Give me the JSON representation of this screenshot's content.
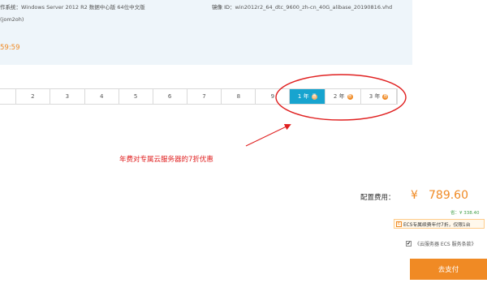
{
  "instance_info": {
    "os_label": "作系统：",
    "os_value": "Windows Server 2012 R2 数据中心版 64位中文版",
    "image_label": "镜像 ID：",
    "image_value": "win2012r2_64_dtc_9600_zh-cn_40G_alibase_20190816.vhd",
    "instance_fragment": "(jom2oh)",
    "countdown": "59:59"
  },
  "duration": {
    "items": [
      {
        "label": ""
      },
      {
        "label": "2"
      },
      {
        "label": "3"
      },
      {
        "label": "4"
      },
      {
        "label": "5"
      },
      {
        "label": "6"
      },
      {
        "label": "7"
      },
      {
        "label": "8"
      },
      {
        "label": "9"
      },
      {
        "label": "1 年",
        "gift": "惠",
        "selected": true
      },
      {
        "label": "2 年",
        "gift": "惠",
        "selected": false
      },
      {
        "label": "3 年",
        "gift": "惠",
        "selected": false
      }
    ]
  },
  "annotation": {
    "text": "年费对专属云服务器的7折优惠",
    "color": "#e02020"
  },
  "summary": {
    "fee_label": "配置费用：",
    "currency": "¥",
    "fee_value": "789.60",
    "savings": "省：¥ 338.40",
    "promo_icon": "E",
    "promo_text": "ECS专属续费年付7折，仅限1台"
  },
  "terms": {
    "checked": true,
    "check_mark": "✔",
    "label": "《云服务器 ECS 服务条款》"
  },
  "actions": {
    "pay_label": "去支付"
  },
  "colors": {
    "accent_orange": "#f08a24",
    "active_blue": "#17a4cf",
    "savings_green": "#44a04a",
    "panel_bg": "#eef5fa"
  }
}
